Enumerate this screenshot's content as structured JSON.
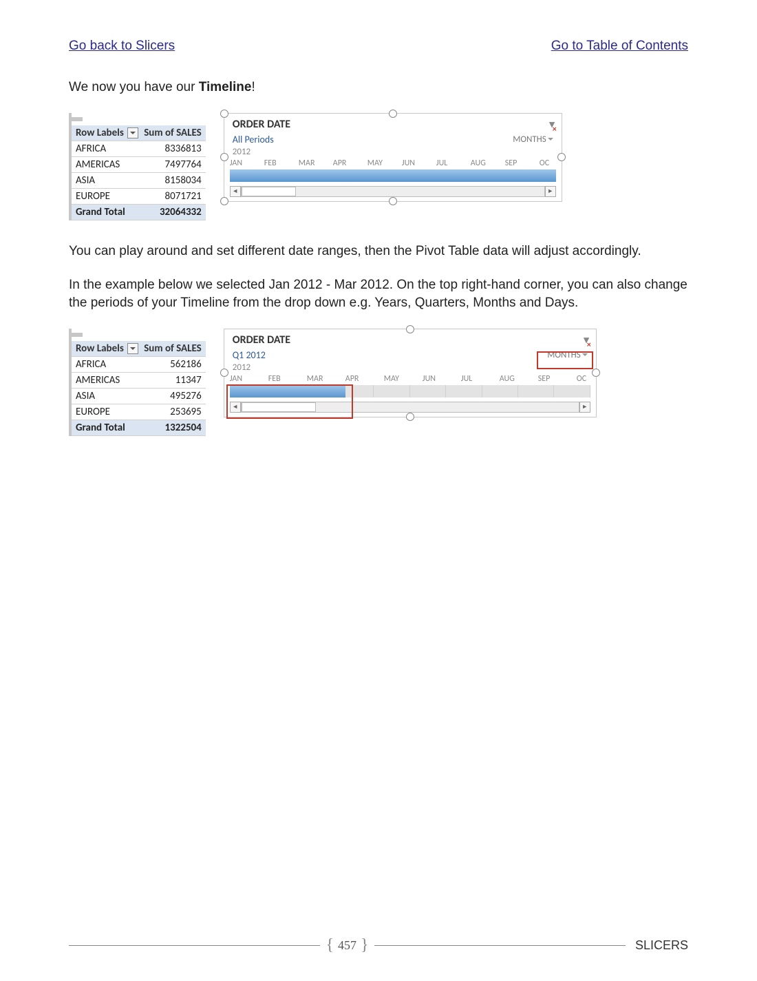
{
  "nav": {
    "back_link": "Go back to Slicers",
    "toc_link": "Go to Table of Contents"
  },
  "text": {
    "intro_pre": "We now you have our ",
    "intro_bold": "Timeline",
    "intro_post": "!",
    "para2": "You can play around and set different date ranges, then the Pivot Table data will adjust accordingly.",
    "para3": "In the example below we selected Jan 2012 - Mar 2012. On the top right-hand corner, you can also change the periods of your Timeline from the drop down e.g. Years, Quarters, Months and Days."
  },
  "pivot1": {
    "col1": "Row Labels",
    "col2": "Sum of SALES",
    "rows": [
      {
        "label": "AFRICA",
        "value": "8336813"
      },
      {
        "label": "AMERICAS",
        "value": "7497764"
      },
      {
        "label": "ASIA",
        "value": "8158034"
      },
      {
        "label": "EUROPE",
        "value": "8071721"
      }
    ],
    "total_label": "Grand Total",
    "total_value": "32064332"
  },
  "pivot2": {
    "col1": "Row Labels",
    "col2": "Sum of SALES",
    "rows": [
      {
        "label": "AFRICA",
        "value": "562186"
      },
      {
        "label": "AMERICAS",
        "value": "11347"
      },
      {
        "label": "ASIA",
        "value": "495276"
      },
      {
        "label": "EUROPE",
        "value": "253695"
      }
    ],
    "total_label": "Grand Total",
    "total_value": "1322504"
  },
  "timeline1": {
    "title": "ORDER DATE",
    "period": "All Periods",
    "units": "MONTHS",
    "year": "2012",
    "months": [
      "JAN",
      "FEB",
      "MAR",
      "APR",
      "MAY",
      "JUN",
      "JUL",
      "AUG",
      "SEP",
      "OC"
    ]
  },
  "timeline2": {
    "title": "ORDER DATE",
    "period": "Q1 2012",
    "units": "MONTHS",
    "year": "2012",
    "months": [
      "JAN",
      "FEB",
      "MAR",
      "APR",
      "MAY",
      "JUN",
      "JUL",
      "AUG",
      "SEP",
      "OC"
    ]
  },
  "footer": {
    "page": "457",
    "section": "SLICERS"
  }
}
